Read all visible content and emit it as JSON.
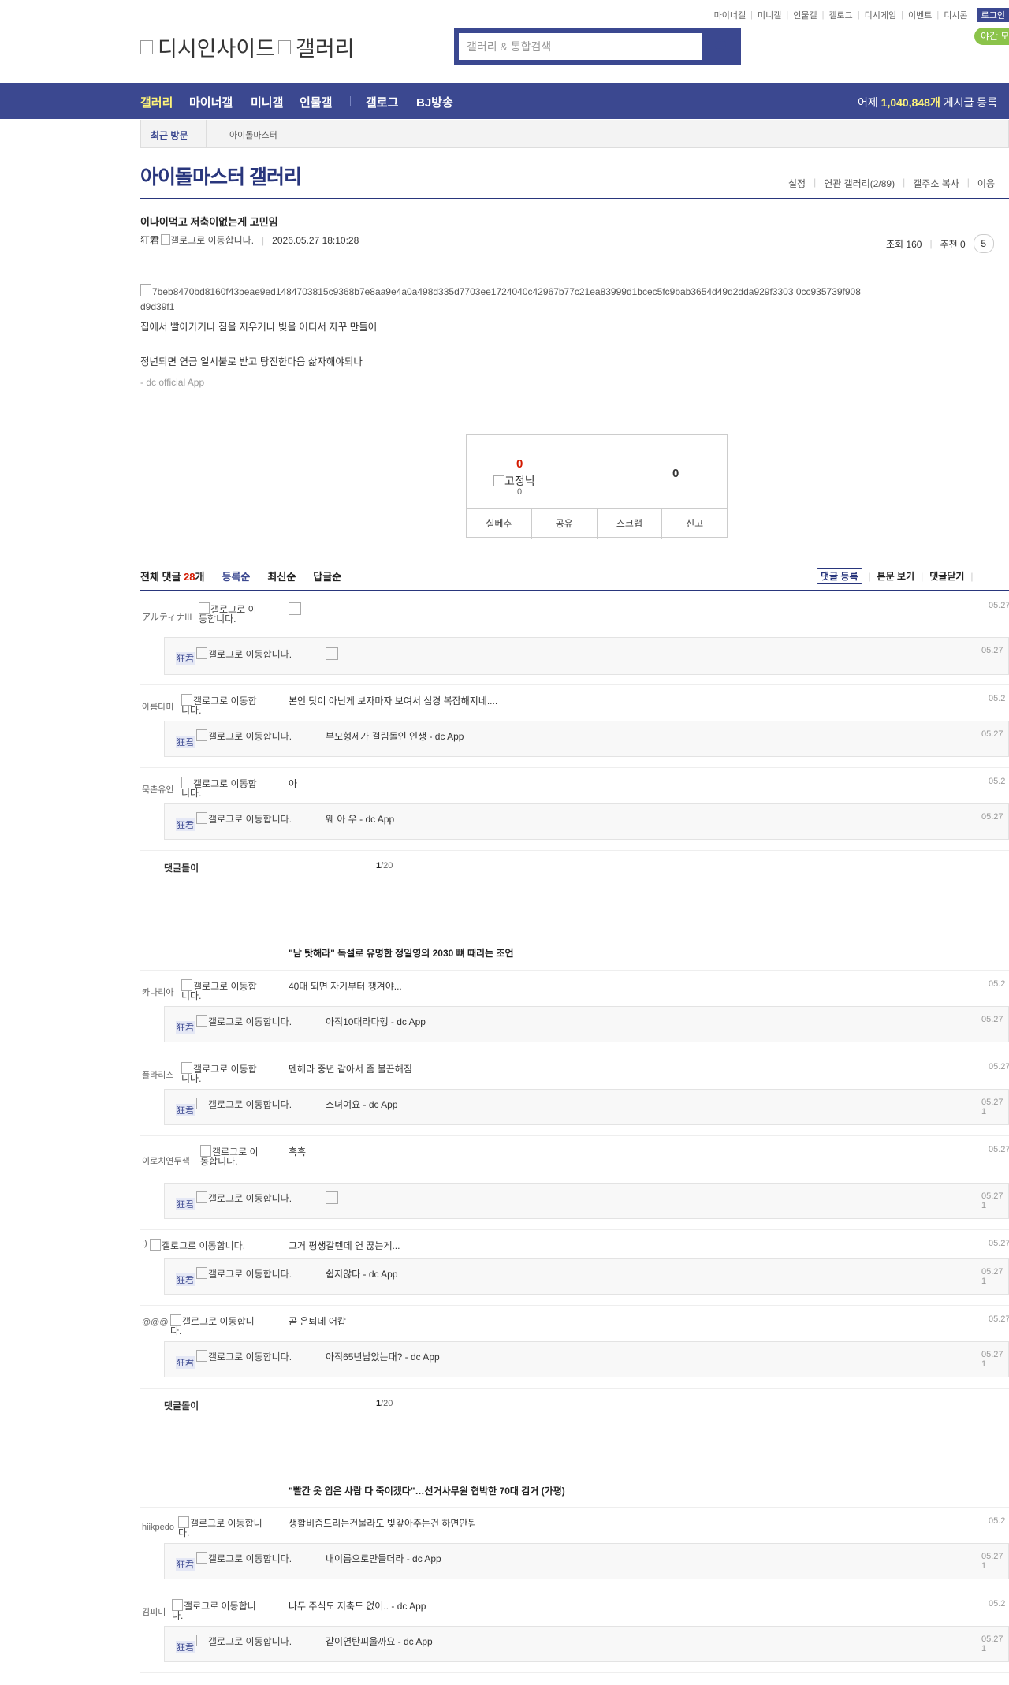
{
  "header": {
    "top_links": [
      "마이너갤",
      "미니갤",
      "인물갤",
      "갤로그",
      "디시게임",
      "이벤트",
      "디시콘"
    ],
    "login_label": "로그인",
    "logo_alt": "디시인사이드",
    "logo_sub_alt": "갤러리",
    "search_placeholder": "갤러리 & 통합검색",
    "night_mode_label": "야간 모"
  },
  "nav": {
    "items": [
      "갤러리",
      "마이너갤",
      "미니갤",
      "인물갤",
      "갤로그",
      "BJ방송"
    ],
    "count_prefix": "어제 ",
    "count_value": "1,040,848개",
    "count_suffix": " 게시글 등록"
  },
  "recent": {
    "label": "최근 방문",
    "gallery": "아이돌마스터"
  },
  "gallery": {
    "title": "아이돌마스터 갤러리",
    "menu": [
      "설정",
      "연관 갤러리(2/89)",
      "갤주소 복사",
      "이용"
    ]
  },
  "post": {
    "title": "이나이먹고 저축이없는게 고민임",
    "author": "狂君",
    "gallog_alt": "갤로그로 이동합니다.",
    "date": "2026.05.27 18:10:28",
    "views": "조회 160",
    "recommend": "추천 0",
    "comment_btn": "5",
    "image_alt": "7beb8470bd8160f43beae9ed1484703815c9368b7e8aa9e4a0a498d335d7703ee1724040c42967b77c21ea83999d1bcec5fc9bab3654d49d2dda929f3303 0cc935739f908d9d39f1",
    "line1": "집에서 빨아가거나 짐을 지우거나 빚을 어디서 자꾸 만들어",
    "line2": "정년되면 연금 일시불로 받고 탕진한다음 삶자해야되나",
    "app_sig": "- dc official App"
  },
  "recommend_box": {
    "up": "0",
    "fix_alt": "고정닉",
    "fix_count": "0",
    "down": "0",
    "buttons": [
      "실베추",
      "공유",
      "스크랩",
      "신고"
    ]
  },
  "comment_bar": {
    "total_prefix": "전체 댓글 ",
    "total_count": "28",
    "total_suffix": "개",
    "tabs": [
      "등록순",
      "최신순",
      "답글순"
    ],
    "tools": [
      "댓글 등록",
      "본문 보기",
      "댓글닫기"
    ]
  },
  "comments": [
    {
      "nick": "アルティナIII",
      "gallog": "갤로그로 이동합니다.",
      "text": "",
      "date": "05.27",
      "reply": {
        "tag": "狂君",
        "gallog": "갤로그로 이동합니다.",
        "text": "",
        "date": "05.27"
      }
    },
    {
      "nick": "아름다미",
      "gallog": "갤로그로 이동합니다.",
      "text": "본인 탓이 아닌게 보자마자 보여서 심경 복잡해지네....",
      "date": "05.2",
      "reply": {
        "tag": "狂君",
        "gallog": "갤로그로 이동합니다.",
        "text": "부모형제가 걸림돌인 인생 - dc App",
        "date": "05.27"
      }
    },
    {
      "nick": "묵촌유인",
      "gallog": "갤로그로 이동합니다.",
      "text": "아",
      "date": "05.2",
      "reply": {
        "tag": "狂君",
        "gallog": "갤로그로 이동합니다.",
        "text": "웨 아 우 - dc App",
        "date": "05.27"
      }
    }
  ],
  "pager": {
    "label": "댓글돌이",
    "current": "1",
    "total": "/20"
  },
  "ad1": "\"남 탓해라\" 독설로 유명한 정일영의 2030 뼈 때리는 조언",
  "comments2": [
    {
      "nick": "카나리아",
      "gallog": "갤로그로 이동합니다.",
      "text": "40대 되면 자기부터 챙겨야...",
      "date": "05.2",
      "reply": {
        "tag": "狂君",
        "gallog": "갤로그로 이동합니다.",
        "text": "아직10대라다행 - dc App",
        "date": "05.27"
      }
    },
    {
      "nick": "플라리스",
      "gallog": "갤로그로 이동합니다.",
      "text": "멘헤라 중년 같아서 좀 불끈해짐",
      "date": "05.27",
      "reply": {
        "tag": "狂君",
        "gallog": "갤로그로 이동합니다.",
        "text": "소녀여요 - dc App",
        "date": "05.27 1"
      }
    },
    {
      "nick": "이로치연두색",
      "gallog": "갤로그로 이동합니다.",
      "text": "흑흑",
      "date": "05.27",
      "reply": {
        "tag": "狂君",
        "gallog": "갤로그로 이동합니다.",
        "text": "",
        "date": "05.27 1"
      }
    },
    {
      "nick": ":)",
      "gallog": "갤로그로 이동합니다.",
      "text": "그거 평생갈텐데 연 끊는게...",
      "date": "05.27",
      "reply": {
        "tag": "狂君",
        "gallog": "갤로그로 이동합니다.",
        "text": "쉽지않다 - dc App",
        "date": "05.27 1"
      }
    },
    {
      "nick": "@@@",
      "gallog": "갤로그로 이동합니다.",
      "text": "곧 은퇴데 어캅",
      "date": "05.27",
      "reply": {
        "tag": "狂君",
        "gallog": "갤로그로 이동합니다.",
        "text": "아직65년남았는대? - dc App",
        "date": "05.27 1"
      }
    }
  ],
  "ad2": "\"빨간 옷 입은 사람 다 죽이겠다\"…선거사무원 협박한 70대 검거 (가평)",
  "comments3": [
    {
      "nick": "hiikpedo",
      "gallog": "갤로그로 이동합니다.",
      "text": "생활비즘드리는건물라도 빚갚아주는건 하면안됨",
      "date": "05.2",
      "reply": {
        "tag": "狂君",
        "gallog": "갤로그로 이동합니다.",
        "text": "내이름으로만들더라 - dc App",
        "date": "05.27 1"
      }
    },
    {
      "nick": "김피미",
      "gallog": "갤로그로 이동합니다.",
      "text": "나두 주식도 저축도 없어.. - dc App",
      "date": "05.2",
      "reply": {
        "tag": "狂君",
        "gallog": "갤로그로 이동합니다.",
        "text": "같이연탄피울까요 - dc App",
        "date": "05.27 1"
      }
    }
  ]
}
